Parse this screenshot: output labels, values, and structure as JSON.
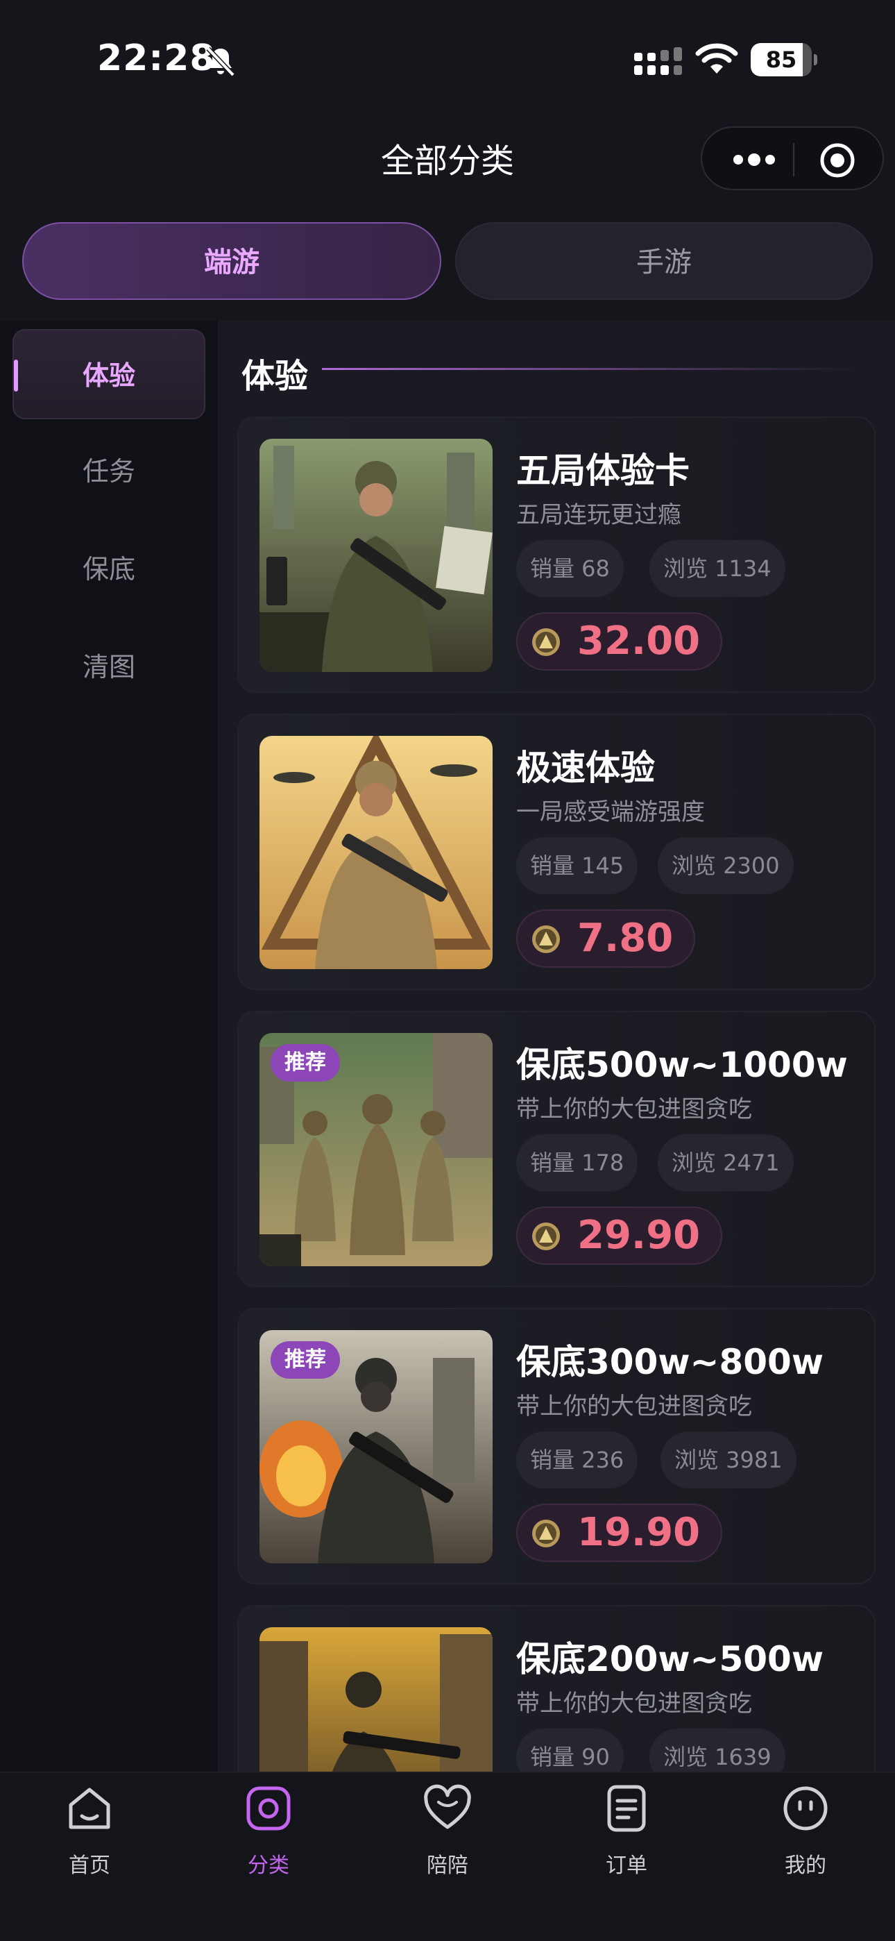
{
  "status_bar": {
    "time": "22:28",
    "battery": "85",
    "battery_level": 0.85
  },
  "nav": {
    "title": "全部分类"
  },
  "platform_tabs": [
    {
      "label": "端游",
      "active": true
    },
    {
      "label": "手游",
      "active": false
    }
  ],
  "sidebar": {
    "items": [
      {
        "label": "体验",
        "active": true
      },
      {
        "label": "任务",
        "active": false
      },
      {
        "label": "保底",
        "active": false
      },
      {
        "label": "清图",
        "active": false
      }
    ]
  },
  "section": {
    "title": "体验"
  },
  "products": [
    {
      "title": "五局体验卡",
      "subtitle": "五局连玩更过瘾",
      "sales": "销量 68",
      "views": "浏览 1134",
      "price": "32.00",
      "badge": ""
    },
    {
      "title": "极速体验",
      "subtitle": "一局感受端游强度",
      "sales": "销量 145",
      "views": "浏览 2300",
      "price": "7.80",
      "badge": ""
    },
    {
      "title": "保底500w~1000w",
      "subtitle": "带上你的大包进图贪吃",
      "sales": "销量 178",
      "views": "浏览 2471",
      "price": "29.90",
      "badge": "推荐"
    },
    {
      "title": "保底300w~800w",
      "subtitle": "带上你的大包进图贪吃",
      "sales": "销量 236",
      "views": "浏览 3981",
      "price": "19.90",
      "badge": "推荐"
    },
    {
      "title": "保底200w~500w",
      "subtitle": "带上你的大包进图贪吃",
      "sales": "销量 90",
      "views": "浏览 1639",
      "price": "",
      "badge": ""
    }
  ],
  "tabbar": [
    {
      "label": "首页",
      "icon": "home-icon",
      "active": false
    },
    {
      "label": "分类",
      "icon": "category-icon",
      "active": true
    },
    {
      "label": "陪陪",
      "icon": "heart-icon",
      "active": false
    },
    {
      "label": "订单",
      "icon": "order-icon",
      "active": false
    },
    {
      "label": "我的",
      "icon": "profile-icon",
      "active": false
    }
  ],
  "colors": {
    "accent": "#c466ef",
    "price": "#f07085",
    "background": "#15161c"
  }
}
